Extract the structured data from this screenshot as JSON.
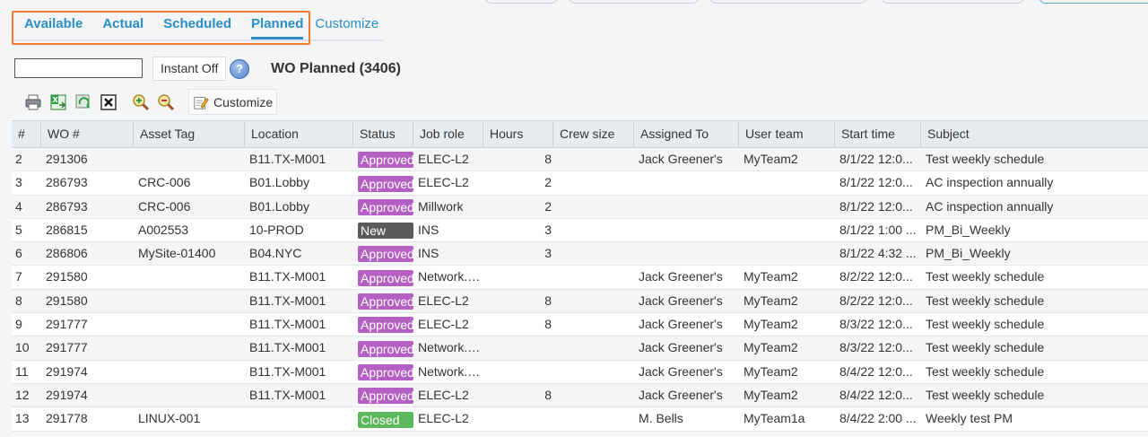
{
  "tabs": [
    {
      "label": "Available",
      "active": false
    },
    {
      "label": "Actual",
      "active": false
    },
    {
      "label": "Scheduled",
      "active": false
    },
    {
      "label": "Planned",
      "active": true
    }
  ],
  "tabs_customize": "Customize",
  "filter": {
    "search_value": "",
    "instant_label": "Instant Off",
    "help_icon": "help-icon",
    "title": "WO Planned (3406)"
  },
  "toolbar": {
    "icons": [
      "print-icon",
      "export-excel-icon",
      "refresh-icon",
      "clear-icon",
      "zoom-in-icon",
      "zoom-out-icon"
    ],
    "customize_label": "Customize"
  },
  "colors": {
    "accent": "#2a8fc6",
    "highlight": "#f07b2a",
    "approved": "#b45fc2",
    "new": "#5a5a5a",
    "closed": "#5cb85c"
  },
  "table": {
    "headers": [
      "#",
      "WO #",
      "Asset Tag",
      "Location",
      "Status",
      "Job role",
      "Hours",
      "Crew size",
      "Assigned To",
      "User team",
      "Start time",
      "Subject"
    ],
    "rows": [
      [
        "2",
        "291306",
        "",
        "B11.TX-M001",
        "Approved",
        "ELEC-L2",
        "8",
        "",
        "Jack Greener's",
        "MyTeam2",
        "8/1/22 12:0...",
        "Test weekly schedule"
      ],
      [
        "3",
        "286793",
        "CRC-006",
        "B01.Lobby",
        "Approved",
        "ELEC-L2",
        "2",
        "",
        "",
        "",
        "8/1/22 12:0...",
        "AC inspection annually"
      ],
      [
        "4",
        "286793",
        "CRC-006",
        "B01.Lobby",
        "Approved",
        "Millwork",
        "2",
        "",
        "",
        "",
        "8/1/22 12:0...",
        "AC inspection annually"
      ],
      [
        "5",
        "286815",
        "A002553",
        "10-PROD",
        "New",
        "INS",
        "3",
        "",
        "",
        "",
        "8/1/22 1:00 ...",
        "PM_Bi_Weekly"
      ],
      [
        "6",
        "286806",
        "MySite-01400",
        "B04.NYC",
        "Approved",
        "INS",
        "3",
        "",
        "",
        "",
        "8/1/22 4:32 ...",
        "PM_Bi_Weekly"
      ],
      [
        "7",
        "291580",
        "",
        "B11.TX-M001",
        "Approved",
        "Network.T...",
        "",
        "",
        "Jack Greener's",
        "MyTeam2",
        "8/2/22 12:0...",
        "Test weekly schedule"
      ],
      [
        "8",
        "291580",
        "",
        "B11.TX-M001",
        "Approved",
        "ELEC-L2",
        "8",
        "",
        "Jack Greener's",
        "MyTeam2",
        "8/2/22 12:0...",
        "Test weekly schedule"
      ],
      [
        "9",
        "291777",
        "",
        "B11.TX-M001",
        "Approved",
        "ELEC-L2",
        "8",
        "",
        "Jack Greener's",
        "MyTeam2",
        "8/3/22 12:0...",
        "Test weekly schedule"
      ],
      [
        "10",
        "291777",
        "",
        "B11.TX-M001",
        "Approved",
        "Network.T...",
        "",
        "",
        "Jack Greener's",
        "MyTeam2",
        "8/3/22 12:0...",
        "Test weekly schedule"
      ],
      [
        "11",
        "291974",
        "",
        "B11.TX-M001",
        "Approved",
        "Network.T...",
        "",
        "",
        "Jack Greener's",
        "MyTeam2",
        "8/4/22 12:0...",
        "Test weekly schedule"
      ],
      [
        "12",
        "291974",
        "",
        "B11.TX-M001",
        "Approved",
        "ELEC-L2",
        "8",
        "",
        "Jack Greener's",
        "MyTeam2",
        "8/4/22 12:0...",
        "Test weekly schedule"
      ],
      [
        "13",
        "291778",
        "LINUX-001",
        "",
        "Closed",
        "ELEC-L2",
        "",
        "",
        "M. Bells",
        "MyTeam1a",
        "8/4/22 2:00 ...",
        "Weekly test PM"
      ]
    ]
  }
}
